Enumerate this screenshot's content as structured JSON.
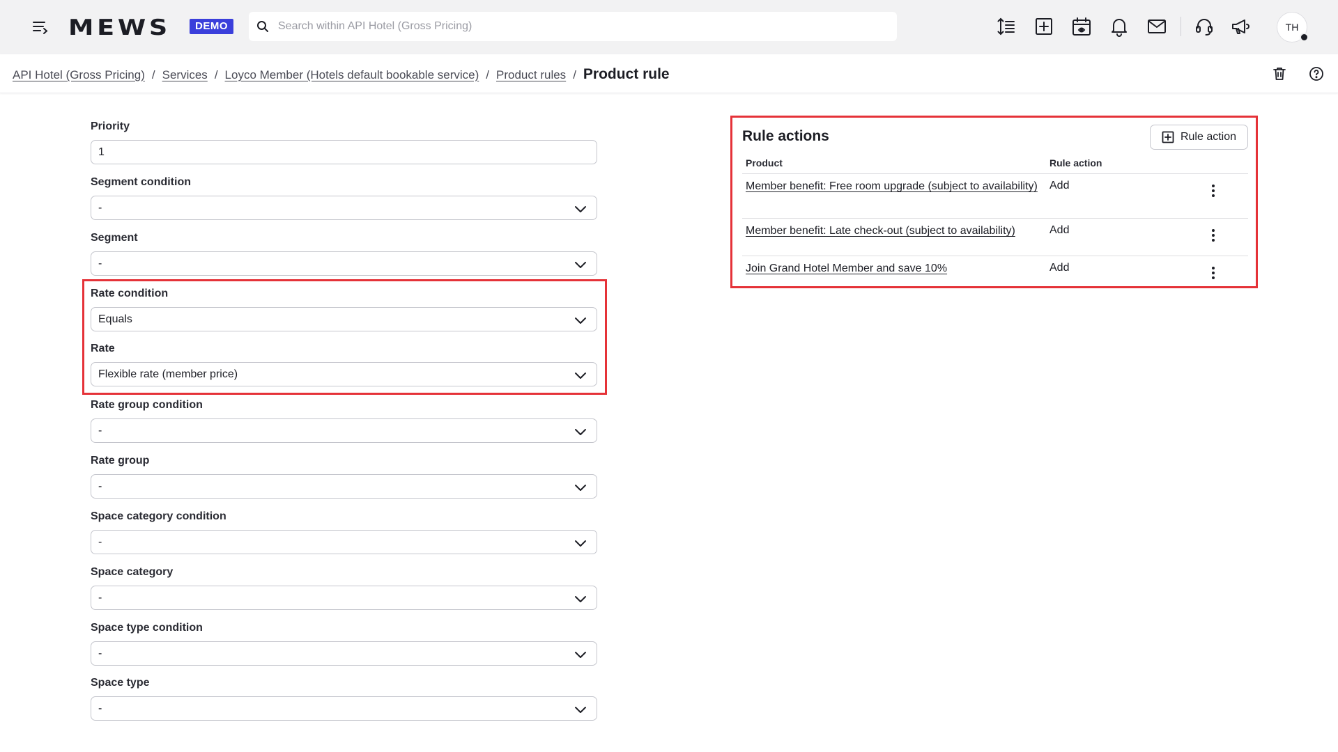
{
  "app": {
    "logo": "MEWS",
    "badge": "DEMO",
    "search_placeholder": "Search within API Hotel (Gross Pricing)",
    "avatar_initials": "TH"
  },
  "breadcrumb": {
    "items": [
      "API Hotel (Gross Pricing)",
      "Services",
      "Loyco Member (Hotels default bookable service)",
      "Product rules"
    ],
    "separator": "/",
    "current": "Product rule"
  },
  "form": {
    "priority_label": "Priority",
    "priority_value": "1",
    "segment_condition_label": "Segment condition",
    "segment_condition_value": "-",
    "segment_label": "Segment",
    "segment_value": "-",
    "rate_condition_label": "Rate condition",
    "rate_condition_value": "Equals",
    "rate_label": "Rate",
    "rate_value": "Flexible rate (member price)",
    "rate_group_condition_label": "Rate group condition",
    "rate_group_condition_value": "-",
    "rate_group_label": "Rate group",
    "rate_group_value": "-",
    "space_category_condition_label": "Space category condition",
    "space_category_condition_value": "-",
    "space_category_label": "Space category",
    "space_category_value": "-",
    "space_type_condition_label": "Space type condition",
    "space_type_condition_value": "-",
    "space_type_label": "Space type",
    "space_type_value": "-"
  },
  "rule_actions": {
    "title": "Rule actions",
    "add_button_label": "Rule action",
    "columns": [
      "Product",
      "Rule action"
    ],
    "rows": [
      {
        "product": "Member benefit: Free room upgrade (subject to availability)",
        "action": "Add"
      },
      {
        "product": "Member benefit: Late check-out (subject to availability)",
        "action": "Add"
      },
      {
        "product": "Join Grand Hotel Member and save 10%",
        "action": "Add"
      }
    ]
  },
  "colors": {
    "topbar_bg": "#f2f2f3",
    "badge_bg": "#3b3fdb",
    "highlight": "#e53238"
  }
}
